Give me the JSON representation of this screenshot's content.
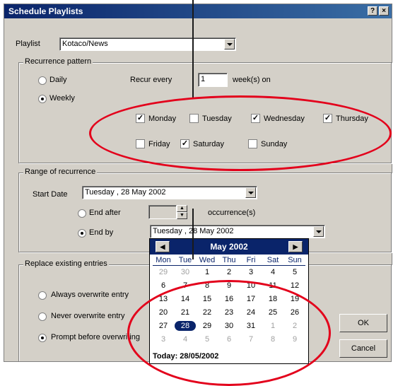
{
  "window": {
    "title": "Schedule Playlists",
    "help_btn": "?",
    "close_btn": "×"
  },
  "playlist": {
    "label": "Playlist",
    "value": "Kotaco/News"
  },
  "recurrence": {
    "group_label": "Recurrence pattern",
    "daily_label": "Daily",
    "weekly_label": "Weekly",
    "recur_every_label": "Recur every",
    "recur_value": "1",
    "weeks_on_label": "week(s) on",
    "days": [
      {
        "label": "Monday",
        "checked": true
      },
      {
        "label": "Tuesday",
        "checked": false
      },
      {
        "label": "Wednesday",
        "checked": true
      },
      {
        "label": "Thursday",
        "checked": true
      },
      {
        "label": "Friday",
        "checked": false
      },
      {
        "label": "Saturday",
        "checked": true
      },
      {
        "label": "Sunday",
        "checked": false
      }
    ]
  },
  "range": {
    "group_label": "Range of recurrence",
    "start_label": "Start Date",
    "start_value": "Tuesday , 28    May    2002",
    "end_after_label": "End after",
    "end_after_value": "",
    "occurrences_label": "occurrence(s)",
    "end_by_label": "End by",
    "end_by_value": "Tuesday , 28    May    2002"
  },
  "replace": {
    "group_label": "Replace existing entries",
    "options": [
      "Always overwrite entry",
      "Never overwrite entry",
      "Prompt before overwriting"
    ],
    "selected": 2
  },
  "buttons": {
    "ok": "OK",
    "cancel": "Cancel"
  },
  "calendar": {
    "month_title": "May 2002",
    "prev": "◀",
    "next": "▶",
    "weekdays": [
      "Mon",
      "Tue",
      "Wed",
      "Thu",
      "Fri",
      "Sat",
      "Sun"
    ],
    "weeks": [
      [
        "29",
        "30",
        "1",
        "2",
        "3",
        "4",
        "5"
      ],
      [
        "6",
        "7",
        "8",
        "9",
        "10",
        "11",
        "12"
      ],
      [
        "13",
        "14",
        "15",
        "16",
        "17",
        "18",
        "19"
      ],
      [
        "20",
        "21",
        "22",
        "23",
        "24",
        "25",
        "26"
      ],
      [
        "27",
        "28",
        "29",
        "30",
        "31",
        "1",
        "2"
      ],
      [
        "3",
        "4",
        "5",
        "6",
        "7",
        "8",
        "9"
      ]
    ],
    "selected_day": "28",
    "today_text": "Today: 28/05/2002"
  },
  "colors": {
    "highlight_ellipse": "#e3001b",
    "selection": "#0a246a"
  }
}
